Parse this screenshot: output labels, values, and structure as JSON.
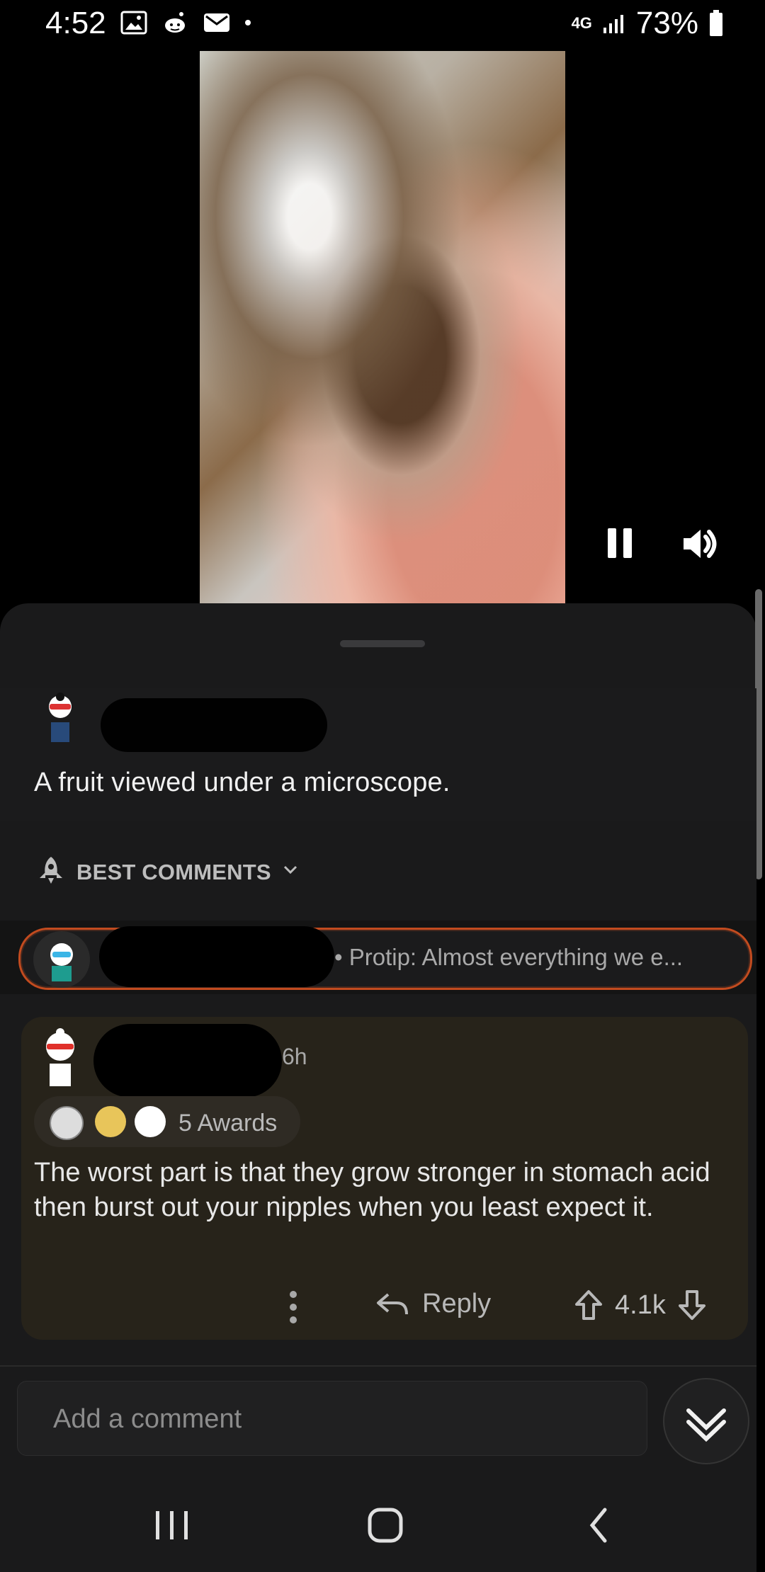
{
  "status_bar": {
    "time": "4:52",
    "network": "4G",
    "battery": "73%"
  },
  "post": {
    "title": "A fruit viewed under a microscope."
  },
  "comments_section": {
    "sort_label": "BEST COMMENTS"
  },
  "pinned_comment": {
    "preview": "• Protip: Almost everything we e..."
  },
  "top_comment": {
    "time": "6h",
    "awards_label": "5 Awards",
    "body": "The worst part is that they grow stronger in stomach acid then burst out your nipples when you least expect it.",
    "reply_label": "Reply",
    "score": "4.1k"
  },
  "composer": {
    "placeholder": "Add a comment"
  },
  "colors": {
    "accent": "#c24b1f",
    "comment_card": "#27231a",
    "sheet": "#1a1a1b"
  },
  "icons": {
    "status_left": [
      "gallery-icon",
      "reddit-icon",
      "mail-icon",
      "dot-icon"
    ],
    "video": [
      "pause-icon",
      "volume-icon"
    ],
    "awards": [
      "silver-award-icon",
      "gold-star-award-icon",
      "wholesome-award-icon"
    ],
    "actions": [
      "more-icon",
      "reply-icon",
      "upvote-icon",
      "downvote-icon",
      "collapse-icon"
    ],
    "nav": [
      "recents-icon",
      "home-icon",
      "back-icon"
    ]
  }
}
